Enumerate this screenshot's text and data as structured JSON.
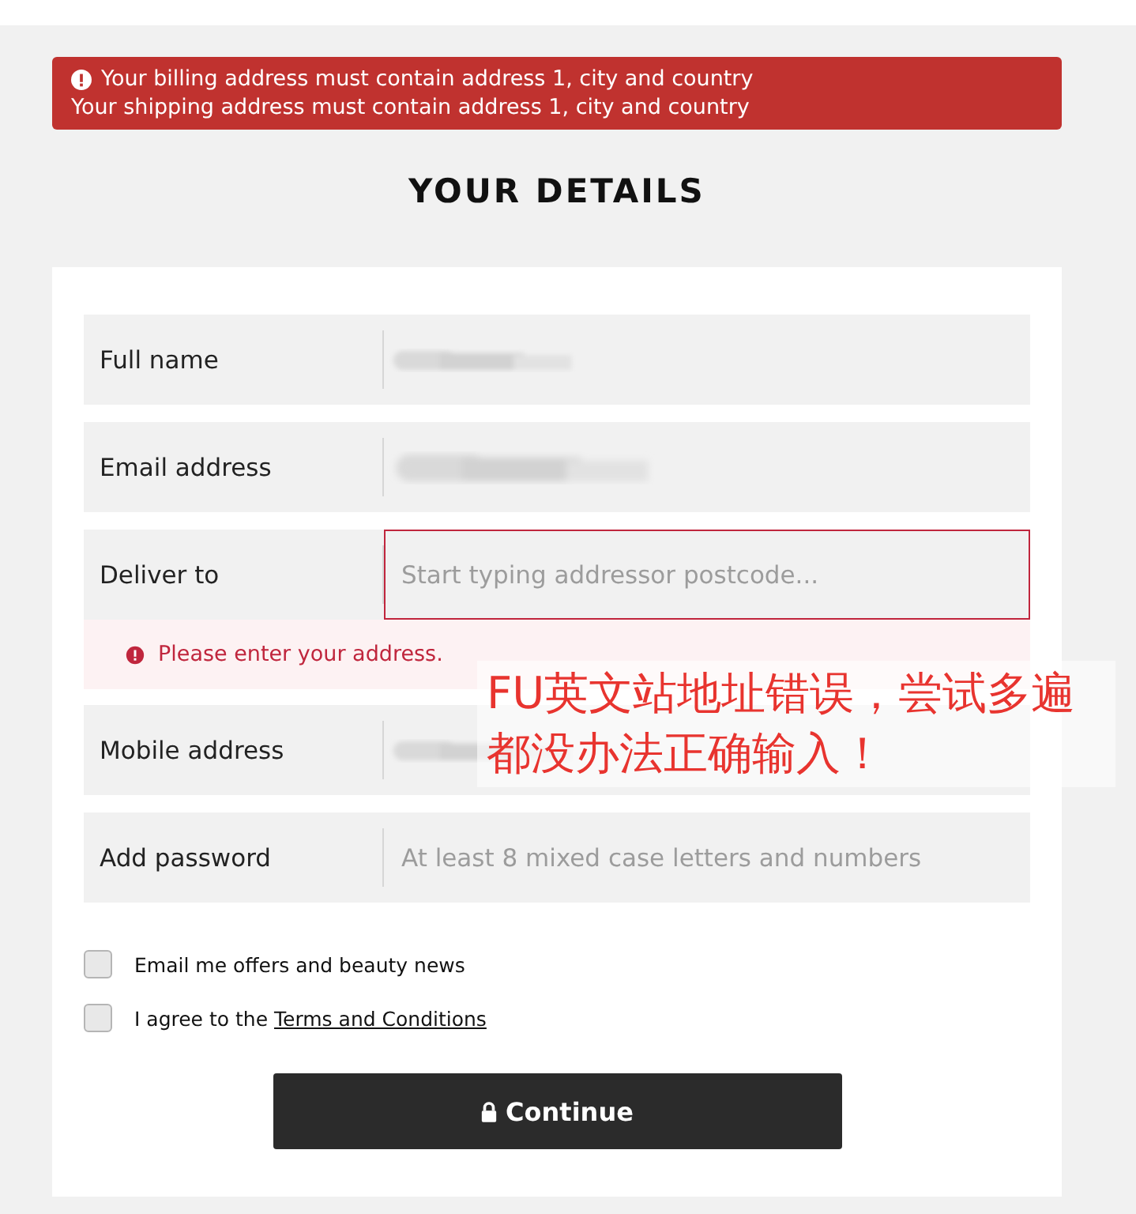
{
  "alerts": [
    {
      "kind": "icon-line",
      "text": "Your billing address must contain address 1, city and country"
    },
    {
      "kind": "plain",
      "text": "Your shipping address must contain address 1, city and country"
    }
  ],
  "heading": "YOUR DETAILS",
  "fields": [
    {
      "label": "Full name",
      "kind": "blurred"
    },
    {
      "label": "Email address",
      "kind": "blurred"
    },
    {
      "label": "Deliver to",
      "kind": "input",
      "placeholder": "Start typing addressor postcode...",
      "invalid": true,
      "error_message": "Please enter your address."
    },
    {
      "label": "Mobile address",
      "kind": "blurred"
    },
    {
      "label": "Add password",
      "kind": "input",
      "placeholder": "At least 8 mixed case letters and numbers",
      "invalid": false
    }
  ],
  "checkboxes": [
    {
      "text": "Email me offers and beauty news",
      "checked": false
    },
    {
      "text": "I agree to the",
      "link": "Terms and Conditions",
      "checked": false
    }
  ],
  "button": {
    "label": "Continue"
  },
  "annotation": {
    "text": "FU英文站地址错误，尝试多遍都没办法正确输入！"
  }
}
